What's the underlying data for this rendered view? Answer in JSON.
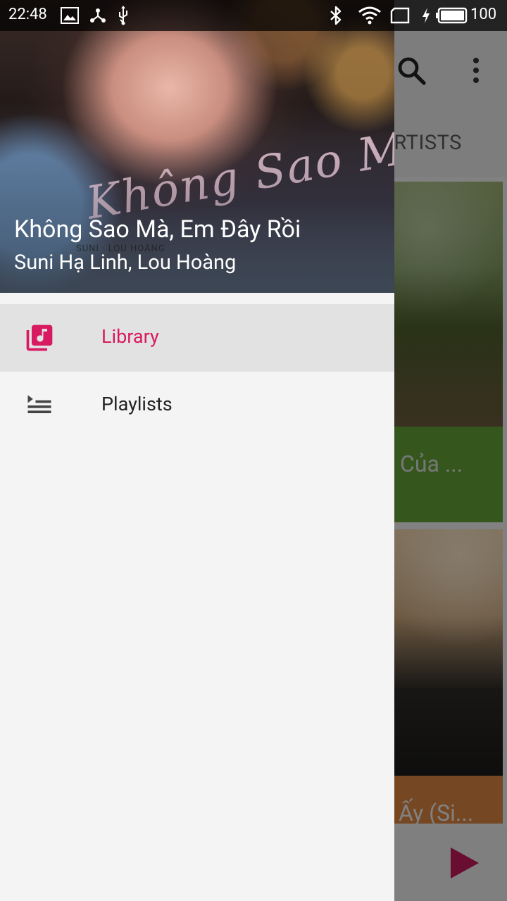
{
  "status_bar": {
    "time": "22:48",
    "battery_percent": "100",
    "left_icons": [
      "image-icon",
      "share-icon",
      "usb-icon"
    ],
    "right_icons": [
      "bluetooth-icon",
      "wifi-icon",
      "sim-icon",
      "charging-icon",
      "battery-icon"
    ]
  },
  "background_app": {
    "toolbar_icons": [
      "search-icon",
      "more-vert-icon"
    ],
    "tab_visible_text": "ARTISTS",
    "cards": [
      {
        "title_fragment": "Của ..."
      },
      {
        "title_fragment": "Ấy (Si..."
      }
    ],
    "miniplayer_icon": "play-icon"
  },
  "drawer": {
    "now_playing": {
      "title": "Không Sao Mà, Em Đây Rồi",
      "artist": "Suni Hạ Linh, Lou Hoàng"
    },
    "items": [
      {
        "label": "Library",
        "icon": "library-music-icon",
        "active": true
      },
      {
        "label": "Playlists",
        "icon": "playlist-icon",
        "active": false
      }
    ]
  },
  "colors": {
    "accent": "#d81b60",
    "active_item_bg": "#e2e2e2",
    "drawer_bg": "#f4f4f4"
  }
}
